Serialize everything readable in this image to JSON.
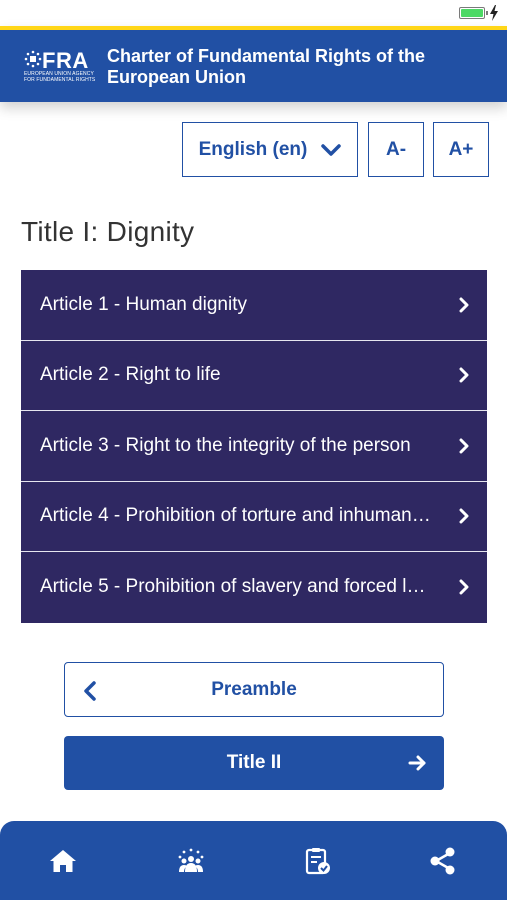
{
  "app": {
    "logo_text": "FRA",
    "logo_subtitle_1": "EUROPEAN UNION AGENCY",
    "logo_subtitle_2": "FOR FUNDAMENTAL RIGHTS",
    "title": "Charter of Fundamental Rights of the European Union"
  },
  "controls": {
    "language": "English (en)",
    "font_decrease": "A-",
    "font_increase": "A+"
  },
  "section": {
    "title": "Title I: Dignity"
  },
  "articles": [
    {
      "label": "Article 1 - Human dignity"
    },
    {
      "label": "Article 2 - Right to life"
    },
    {
      "label": "Article 3 - Right to the integrity of the person"
    },
    {
      "label": "Article 4 - Prohibition of torture and inhuman…"
    },
    {
      "label": "Article 5 - Prohibition of slavery and forced l…"
    }
  ],
  "navigation": {
    "previous": "Preamble",
    "next": "Title II"
  },
  "tabbar": {
    "icons": [
      "home-icon",
      "community-icon",
      "checklist-icon",
      "share-icon"
    ]
  },
  "colors": {
    "brand_blue": "#2150a4",
    "article_purple": "#2f2862",
    "accent_yellow": "#ffd617",
    "battery_green": "#4cd964"
  }
}
